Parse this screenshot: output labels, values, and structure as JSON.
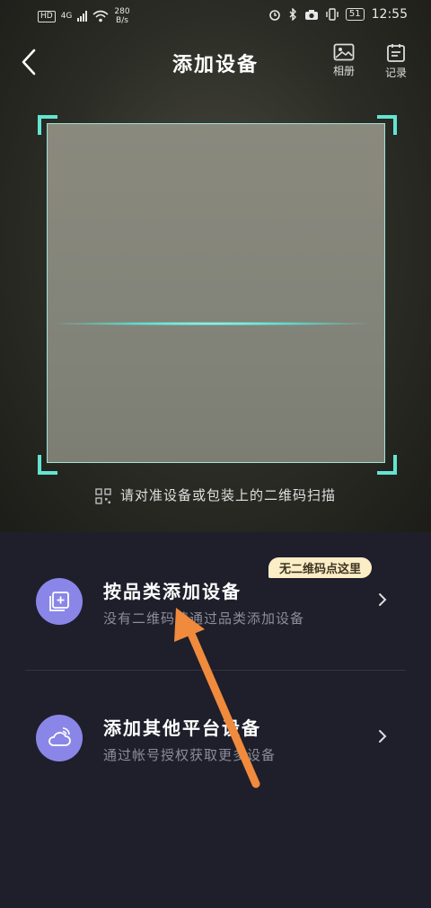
{
  "status_bar": {
    "hd": "HD",
    "signal": "4G",
    "net_speed_value": "280",
    "net_speed_unit": "B/s",
    "battery": "51",
    "time": "12:55"
  },
  "header": {
    "title": "添加设备",
    "album_label": "相册",
    "record_label": "记录"
  },
  "scanner": {
    "hint": "请对准设备或包装上的二维码扫描"
  },
  "badge": "无二维码点这里",
  "options": [
    {
      "title": "按品类添加设备",
      "subtitle": "没有二维码请通过品类添加设备",
      "icon": "add-square-icon"
    },
    {
      "title": "添加其他平台设备",
      "subtitle": "通过帐号授权获取更多设备",
      "icon": "cloud-icon"
    }
  ],
  "colors": {
    "accent_scan": "#63e4d2",
    "icon_circle": "#8a86e8",
    "background": "#1e1f2b",
    "badge_bg": "#fbeec6",
    "annotation_arrow": "#f08a3c"
  }
}
